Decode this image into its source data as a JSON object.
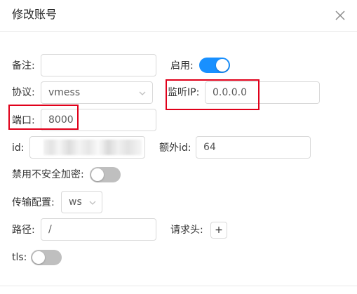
{
  "dialog": {
    "title": "修改账号"
  },
  "form": {
    "remark_label": "备注:",
    "remark_value": "",
    "enable_label": "启用:",
    "enable_on": true,
    "protocol_label": "协议:",
    "protocol_value": "vmess",
    "listen_ip_label": "监听IP:",
    "listen_ip_value": "0.0.0.0",
    "port_label": "端口:",
    "port_value": "8000",
    "id_label": "id:",
    "extra_id_label": "额外id:",
    "extra_id_value": "64",
    "insecure_label": "禁用不安全加密:",
    "insecure_on": false,
    "transport_label": "传输配置:",
    "transport_value": "ws",
    "path_label": "路径:",
    "path_value": "/",
    "header_label": "请求头:",
    "header_add": "+",
    "tls_label": "tls:",
    "tls_on": false
  },
  "colors": {
    "switch_on": "#1890ff",
    "switch_off": "#bfbfbf",
    "highlight": "#e0001a"
  }
}
